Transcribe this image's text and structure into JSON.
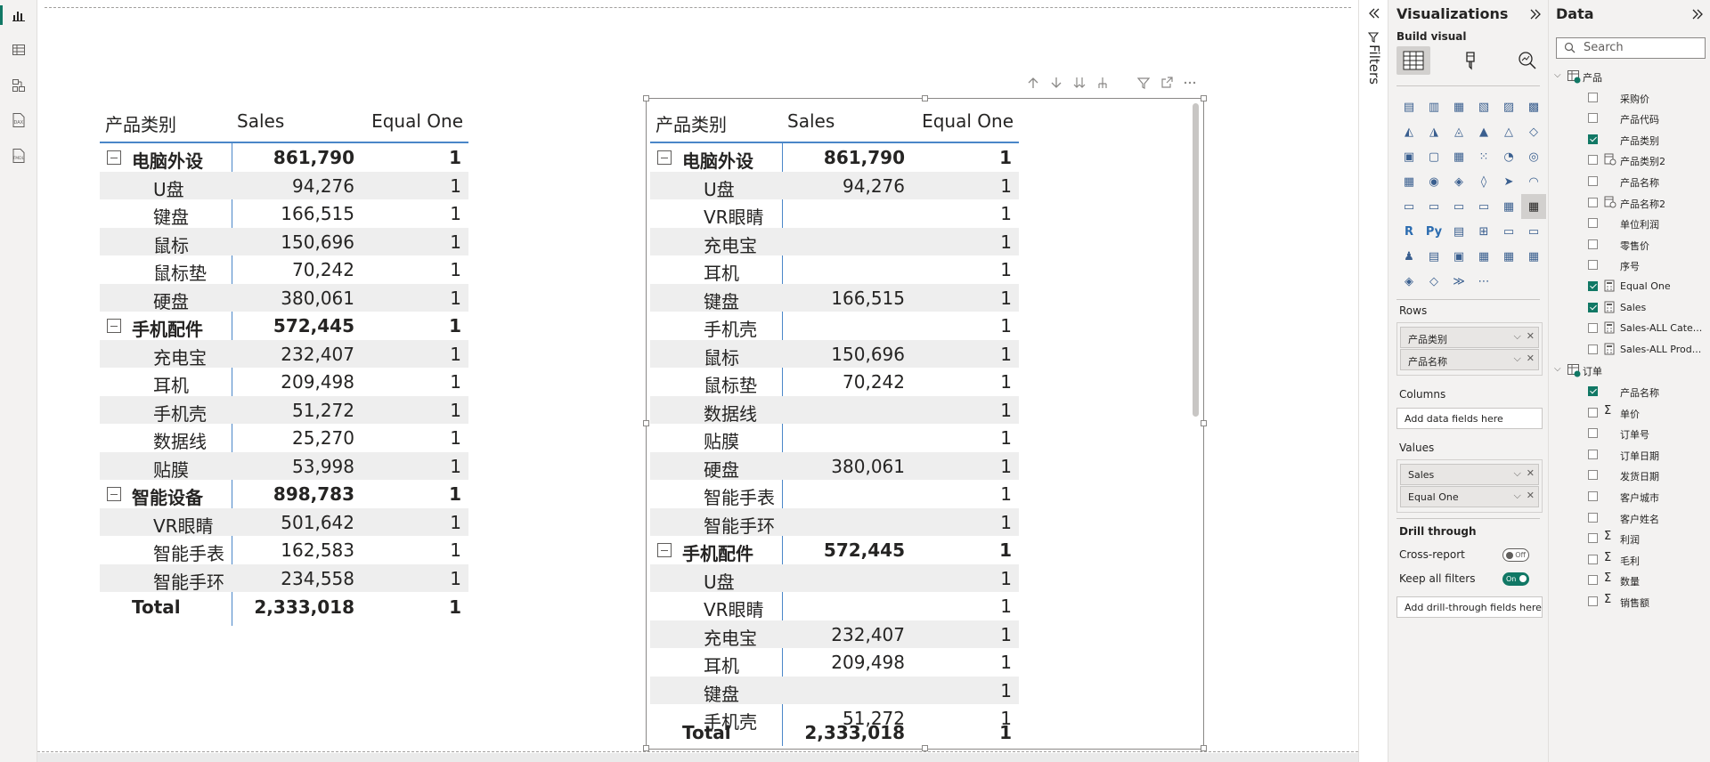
{
  "rail": {
    "icons": [
      "report-icon",
      "table-view-icon",
      "model-view-icon",
      "dax-query-icon",
      "tmdl-icon"
    ],
    "labels": [
      "DAX",
      "TMDL"
    ]
  },
  "matrix1": {
    "headers": [
      "产品类别",
      "Sales",
      "Equal One"
    ],
    "rows": [
      {
        "type": "cat",
        "c1": "电脑外设",
        "c2": "861,790",
        "c3": "1"
      },
      {
        "type": "item",
        "c1": "U盘",
        "c2": "94,276",
        "c3": "1"
      },
      {
        "type": "item",
        "c1": "键盘",
        "c2": "166,515",
        "c3": "1"
      },
      {
        "type": "item",
        "c1": "鼠标",
        "c2": "150,696",
        "c3": "1"
      },
      {
        "type": "item",
        "c1": "鼠标垫",
        "c2": "70,242",
        "c3": "1"
      },
      {
        "type": "item",
        "c1": "硬盘",
        "c2": "380,061",
        "c3": "1"
      },
      {
        "type": "cat",
        "c1": "手机配件",
        "c2": "572,445",
        "c3": "1"
      },
      {
        "type": "item",
        "c1": "充电宝",
        "c2": "232,407",
        "c3": "1"
      },
      {
        "type": "item",
        "c1": "耳机",
        "c2": "209,498",
        "c3": "1"
      },
      {
        "type": "item",
        "c1": "手机壳",
        "c2": "51,272",
        "c3": "1"
      },
      {
        "type": "item",
        "c1": "数据线",
        "c2": "25,270",
        "c3": "1"
      },
      {
        "type": "item",
        "c1": "贴膜",
        "c2": "53,998",
        "c3": "1"
      },
      {
        "type": "cat",
        "c1": "智能设备",
        "c2": "898,783",
        "c3": "1"
      },
      {
        "type": "item",
        "c1": "VR眼睛",
        "c2": "501,642",
        "c3": "1"
      },
      {
        "type": "item",
        "c1": "智能手表",
        "c2": "162,583",
        "c3": "1"
      },
      {
        "type": "item",
        "c1": "智能手环",
        "c2": "234,558",
        "c3": "1"
      }
    ],
    "total": {
      "c1": "Total",
      "c2": "2,333,018",
      "c3": "1"
    }
  },
  "matrix2": {
    "headers": [
      "产品类别",
      "Sales",
      "Equal One"
    ],
    "rows": [
      {
        "type": "cat",
        "c1": "电脑外设",
        "c2": "861,790",
        "c3": "1"
      },
      {
        "type": "item",
        "c1": "U盘",
        "c2": "94,276",
        "c3": "1"
      },
      {
        "type": "item",
        "c1": "VR眼睛",
        "c2": "",
        "c3": "1"
      },
      {
        "type": "item",
        "c1": "充电宝",
        "c2": "",
        "c3": "1"
      },
      {
        "type": "item",
        "c1": "耳机",
        "c2": "",
        "c3": "1"
      },
      {
        "type": "item",
        "c1": "键盘",
        "c2": "166,515",
        "c3": "1"
      },
      {
        "type": "item",
        "c1": "手机壳",
        "c2": "",
        "c3": "1"
      },
      {
        "type": "item",
        "c1": "鼠标",
        "c2": "150,696",
        "c3": "1"
      },
      {
        "type": "item",
        "c1": "鼠标垫",
        "c2": "70,242",
        "c3": "1"
      },
      {
        "type": "item",
        "c1": "数据线",
        "c2": "",
        "c3": "1"
      },
      {
        "type": "item",
        "c1": "贴膜",
        "c2": "",
        "c3": "1"
      },
      {
        "type": "item",
        "c1": "硬盘",
        "c2": "380,061",
        "c3": "1"
      },
      {
        "type": "item",
        "c1": "智能手表",
        "c2": "",
        "c3": "1"
      },
      {
        "type": "item",
        "c1": "智能手环",
        "c2": "",
        "c3": "1"
      },
      {
        "type": "cat",
        "c1": "手机配件",
        "c2": "572,445",
        "c3": "1"
      },
      {
        "type": "item",
        "c1": "U盘",
        "c2": "",
        "c3": "1"
      },
      {
        "type": "item",
        "c1": "VR眼睛",
        "c2": "",
        "c3": "1"
      },
      {
        "type": "item",
        "c1": "充电宝",
        "c2": "232,407",
        "c3": "1"
      },
      {
        "type": "item",
        "c1": "耳机",
        "c2": "209,498",
        "c3": "1"
      },
      {
        "type": "item",
        "c1": "键盘",
        "c2": "",
        "c3": "1"
      },
      {
        "type": "item",
        "c1": "手机壳",
        "c2": "51,272",
        "c3": "1"
      }
    ],
    "total": {
      "c1": "Total",
      "c2": "2,333,018",
      "c3": "1"
    }
  },
  "filters": {
    "label": "Filters"
  },
  "viz": {
    "title": "Visualizations",
    "build_visual": "Build visual",
    "rows_label": "Rows",
    "rows_fields": [
      "产品类别",
      "产品名称"
    ],
    "columns_label": "Columns",
    "columns_placeholder": "Add data fields here",
    "values_label": "Values",
    "values_fields": [
      "Sales",
      "Equal One"
    ],
    "drill_label": "Drill through",
    "cross_report": "Cross-report",
    "cross_report_state": "Off",
    "keep_filters": "Keep all filters",
    "keep_filters_state": "On",
    "drill_placeholder": "Add drill-through fields here",
    "r_label": "R",
    "py_label": "Py"
  },
  "data_pane": {
    "title": "Data",
    "search_placeholder": "Search",
    "tables": [
      {
        "name": "产品",
        "fields": [
          {
            "name": "采购价",
            "checked": false,
            "icon": "none"
          },
          {
            "name": "产品代码",
            "checked": false,
            "icon": "none"
          },
          {
            "name": "产品类别",
            "checked": true,
            "icon": "none"
          },
          {
            "name": "产品类别2",
            "checked": false,
            "icon": "hierarchy"
          },
          {
            "name": "产品名称",
            "checked": false,
            "icon": "none"
          },
          {
            "name": "产品名称2",
            "checked": false,
            "icon": "hierarchy"
          },
          {
            "name": "单位利润",
            "checked": false,
            "icon": "none"
          },
          {
            "name": "零售价",
            "checked": false,
            "icon": "none"
          },
          {
            "name": "序号",
            "checked": false,
            "icon": "none"
          },
          {
            "name": "Equal One",
            "checked": true,
            "icon": "measure"
          },
          {
            "name": "Sales",
            "checked": true,
            "icon": "measure"
          },
          {
            "name": "Sales-ALL Cate...",
            "checked": false,
            "icon": "measure"
          },
          {
            "name": "Sales-ALL Prod...",
            "checked": false,
            "icon": "measure"
          }
        ]
      },
      {
        "name": "订单",
        "fields": [
          {
            "name": "产品名称",
            "checked": true,
            "icon": "none"
          },
          {
            "name": "单价",
            "checked": false,
            "icon": "sigma"
          },
          {
            "name": "订单号",
            "checked": false,
            "icon": "none"
          },
          {
            "name": "订单日期",
            "checked": false,
            "icon": "none"
          },
          {
            "name": "发货日期",
            "checked": false,
            "icon": "none"
          },
          {
            "name": "客户城市",
            "checked": false,
            "icon": "none"
          },
          {
            "name": "客户姓名",
            "checked": false,
            "icon": "none"
          },
          {
            "name": "利润",
            "checked": false,
            "icon": "sigma"
          },
          {
            "name": "毛利",
            "checked": false,
            "icon": "sigma"
          },
          {
            "name": "数量",
            "checked": false,
            "icon": "sigma"
          },
          {
            "name": "销售额",
            "checked": false,
            "icon": "sigma"
          }
        ]
      }
    ]
  },
  "colors": {
    "accent": "#117865",
    "matrix_line": "#4a86c8",
    "row_band": "#eeeeee"
  }
}
